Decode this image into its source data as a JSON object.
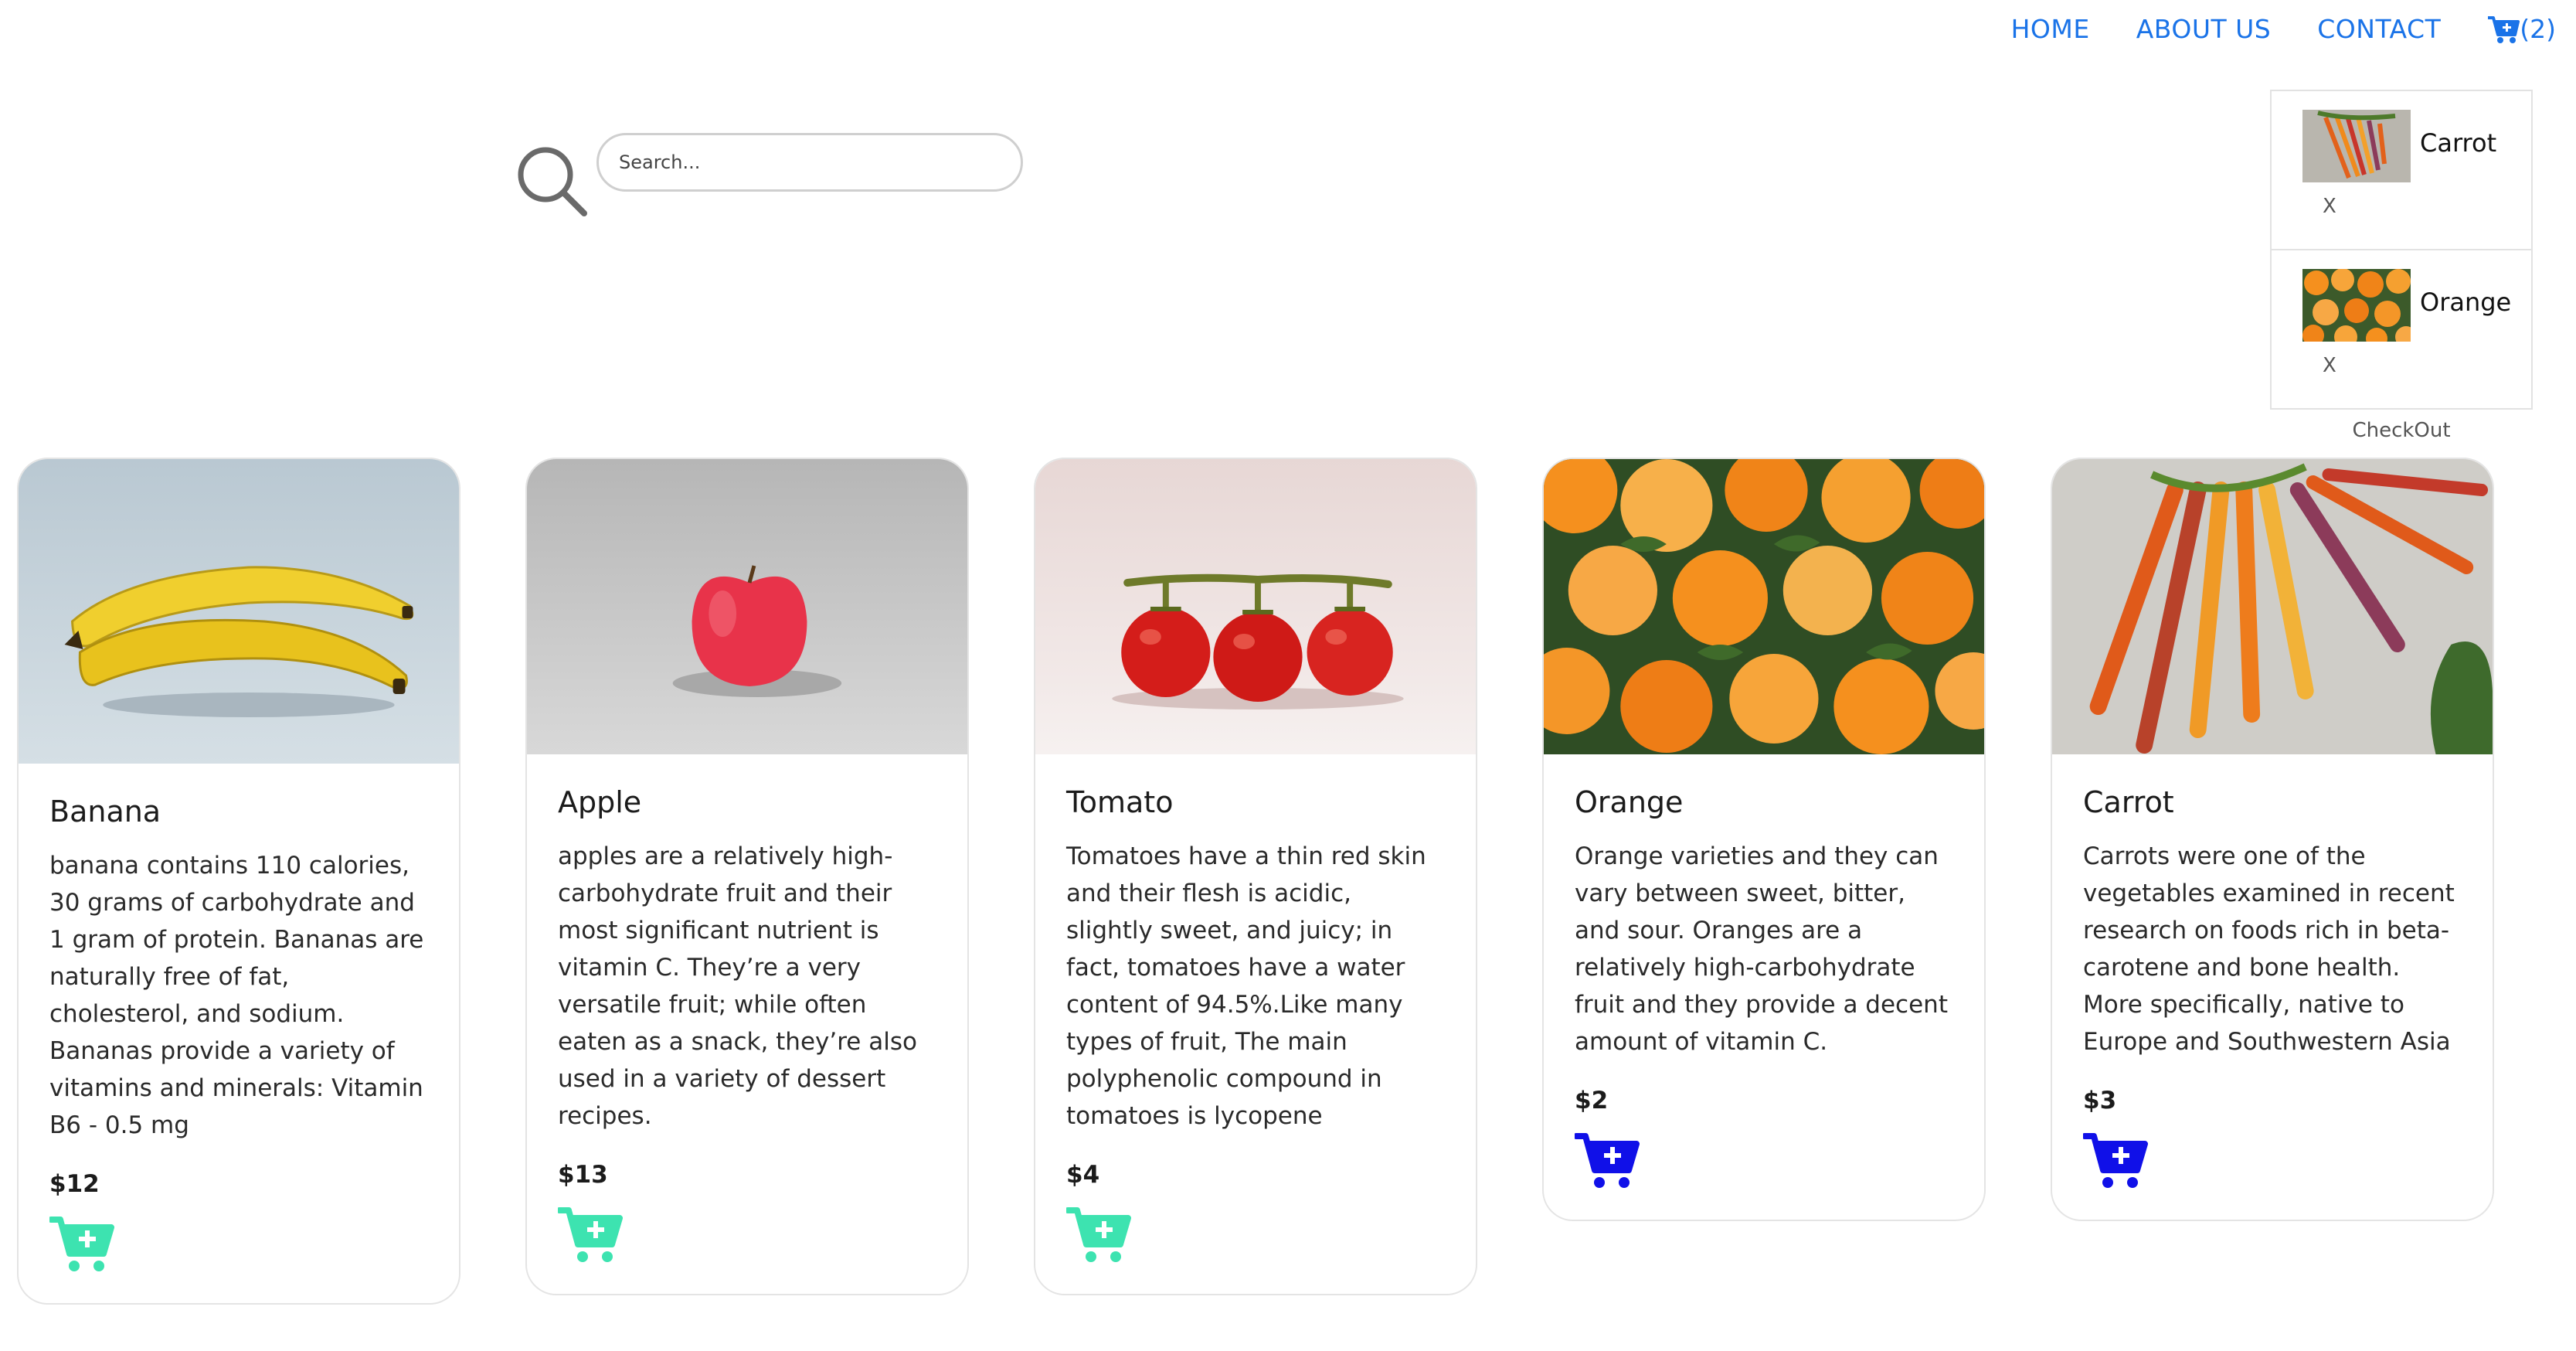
{
  "nav": {
    "home": "HOME",
    "about": "ABOUT US",
    "contact": "CONTACT",
    "cart_count": "(2)",
    "cart_icon": "cart-icon",
    "link_color": "#1a73e8"
  },
  "search": {
    "placeholder": "Search...",
    "icon": "search-icon"
  },
  "cart": {
    "items": [
      {
        "name": "Carrot",
        "remove": "X",
        "thumb": "carrot-thumbnail"
      },
      {
        "name": "Orange",
        "remove": "X",
        "thumb": "orange-thumbnail"
      }
    ],
    "checkout": "CheckOut"
  },
  "products": [
    {
      "name": "Banana",
      "description": "banana contains 110 calories, 30 grams of carbohydrate and 1 gram of protein. Bananas are naturally free of fat, cholesterol, and sodium. Bananas provide a variety of vitamins and minerals: Vitamin B6 - 0.5 mg",
      "price": "$12",
      "add_icon": "cart-plus-icon",
      "icon_color": "#3de3b0"
    },
    {
      "name": "Apple",
      "description": "apples are a relatively high-carbohydrate fruit and their most significant nutrient is vitamin C. They’re a very versatile fruit; while often eaten as a snack, they’re also used in a variety of dessert recipes.",
      "price": "$13",
      "add_icon": "cart-plus-icon",
      "icon_color": "#3de3b0"
    },
    {
      "name": "Tomato",
      "description": "Tomatoes have a thin red skin and their flesh is acidic, slightly sweet, and juicy; in fact, tomatoes have a water content of 94.5%.Like many types of fruit, The main polyphenolic compound in tomatoes is lycopene",
      "price": "$4",
      "add_icon": "cart-plus-icon",
      "icon_color": "#3de3b0"
    },
    {
      "name": "Orange",
      "description": "Orange varieties and they can vary between sweet, bitter, and sour. Oranges are a relatively high-carbohydrate fruit and they provide a decent amount of vitamin C.",
      "price": "$2",
      "add_icon": "cart-plus-icon",
      "icon_color": "#1010e8"
    },
    {
      "name": "Carrot",
      "description": "Carrots were one of the vegetables examined in recent research on foods rich in beta-carotene and bone health. More specifically, native to Europe and Southwestern Asia",
      "price": "$3",
      "add_icon": "cart-plus-icon",
      "icon_color": "#1010e8"
    }
  ]
}
